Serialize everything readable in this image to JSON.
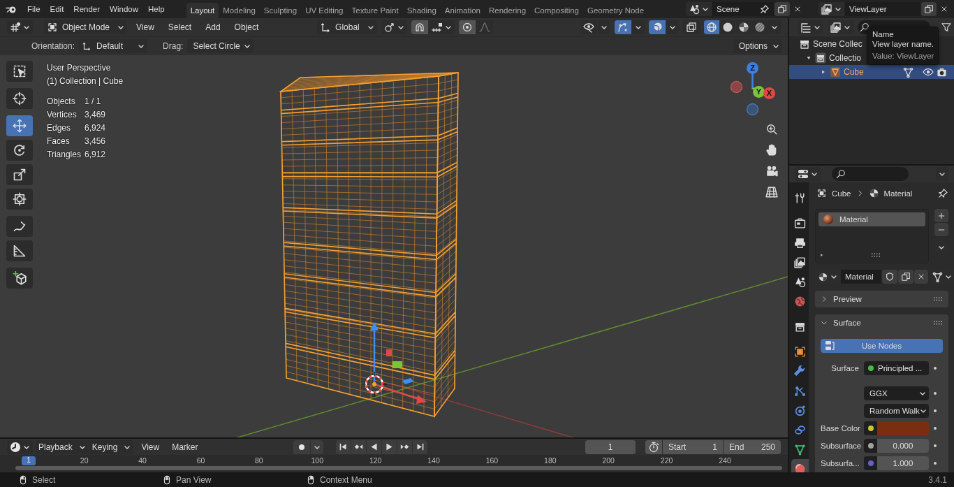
{
  "top_bar": {
    "menus": [
      "File",
      "Edit",
      "Render",
      "Window",
      "Help"
    ],
    "workspaces": [
      {
        "label": "Layout",
        "selected": true
      },
      {
        "label": "Modeling",
        "selected": false
      },
      {
        "label": "Sculpting",
        "selected": false
      },
      {
        "label": "UV Editing",
        "selected": false
      },
      {
        "label": "Texture Paint",
        "selected": false
      },
      {
        "label": "Shading",
        "selected": false
      },
      {
        "label": "Animation",
        "selected": false
      },
      {
        "label": "Rendering",
        "selected": false
      },
      {
        "label": "Compositing",
        "selected": false
      },
      {
        "label": "Geometry Node",
        "selected": false
      }
    ],
    "scene": "Scene",
    "view_layer": "ViewLayer"
  },
  "viewport_header": {
    "mode": "Object Mode",
    "menus": [
      "View",
      "Select",
      "Add",
      "Object"
    ],
    "orientation": "Global",
    "snap": false,
    "proportional": false,
    "toggles": [
      {
        "kind": "visibility",
        "on": false
      },
      {
        "kind": "gizmos",
        "on": true
      },
      {
        "kind": "overlays",
        "on": true
      },
      {
        "kind": "xray",
        "on": false
      }
    ],
    "shading": [
      {
        "kind": "wireframe",
        "selected": true
      },
      {
        "kind": "solid",
        "selected": false
      },
      {
        "kind": "material",
        "selected": false
      },
      {
        "kind": "rendered",
        "selected": false
      }
    ]
  },
  "tool_settings": {
    "orientation_label": "Orientation:",
    "orientation": "Default",
    "drag_label": "Drag:",
    "drag": "Select Circle",
    "options": "Options"
  },
  "toolbar": [
    {
      "tools": [
        {
          "kind": "select",
          "selected": false
        }
      ]
    },
    {
      "tools": [
        {
          "kind": "cursor",
          "selected": false
        }
      ]
    },
    {
      "tools": [
        {
          "kind": "move",
          "selected": true
        },
        {
          "kind": "rotate",
          "selected": false
        },
        {
          "kind": "scale",
          "selected": false
        },
        {
          "kind": "transform",
          "selected": false
        }
      ]
    },
    {
      "tools": [
        {
          "kind": "annotate",
          "selected": false
        },
        {
          "kind": "measure",
          "selected": false
        }
      ]
    },
    {
      "tools": [
        {
          "kind": "add_cube",
          "selected": false
        }
      ]
    }
  ],
  "viewport": {
    "perspective": "User Perspective",
    "collection": "(1) Collection | Cube",
    "stats": [
      {
        "label": "Objects",
        "value": "1 / 1"
      },
      {
        "label": "Vertices",
        "value": "3,469"
      },
      {
        "label": "Edges",
        "value": "6,924"
      },
      {
        "label": "Faces",
        "value": "3,456"
      },
      {
        "label": "Triangles",
        "value": "6,912"
      }
    ],
    "gizmo": {
      "x": "X",
      "y": "Y",
      "z": "Z"
    }
  },
  "timeline": {
    "menus": [
      "Playback",
      "Keying",
      "View",
      "Marker"
    ],
    "current_frame": "1",
    "start_label": "Start",
    "start": "1",
    "end_label": "End",
    "end": "250",
    "frame_marker": "1",
    "ruler": [
      "20",
      "40",
      "60",
      "80",
      "100",
      "120",
      "140",
      "160",
      "180",
      "200",
      "220",
      "240"
    ]
  },
  "outliner": {
    "tree": [
      {
        "label": "Scene Collec",
        "kind": "scene",
        "selected": false,
        "children": [
          {
            "label": "Collectio",
            "kind": "collection",
            "expanded": true,
            "selected": false,
            "children": [
              {
                "label": "Cube",
                "kind": "object",
                "expanded": false,
                "selected": true,
                "visible": true
              }
            ]
          }
        ]
      }
    ],
    "tooltip": {
      "title": "Name",
      "description": "View layer name.",
      "value": "Value: ViewLayer"
    }
  },
  "properties": {
    "tab_groups": [
      {
        "tabs": [
          {
            "kind": "tool",
            "selected": false
          }
        ]
      },
      {
        "tabs": [
          {
            "kind": "render",
            "selected": false
          },
          {
            "kind": "output",
            "selected": false
          },
          {
            "kind": "view_layer",
            "selected": false
          },
          {
            "kind": "scene",
            "selected": false
          },
          {
            "kind": "world",
            "selected": false
          }
        ]
      },
      {
        "tabs": [
          {
            "kind": "collection",
            "selected": false
          }
        ]
      },
      {
        "tabs": [
          {
            "kind": "object",
            "selected": false
          },
          {
            "kind": "modifiers",
            "selected": false
          },
          {
            "kind": "particles",
            "selected": false
          },
          {
            "kind": "physics",
            "selected": false
          },
          {
            "kind": "constraints",
            "selected": false
          },
          {
            "kind": "data",
            "selected": false
          },
          {
            "kind": "material",
            "selected": true
          }
        ]
      }
    ],
    "breadcrumb": [
      "Cube",
      "Material"
    ],
    "slots": [
      {
        "label": "Material",
        "selected": true
      }
    ],
    "datablock": "Material",
    "panels": [
      {
        "title": "Preview",
        "expanded": false
      },
      {
        "title": "Surface",
        "expanded": true
      }
    ],
    "use_nodes": "Use Nodes",
    "fields": [
      {
        "kind": "link",
        "label": "Surface",
        "value": "Principled ...",
        "color": "#3fbf3f"
      },
      {
        "kind": "dropdown",
        "value": "GGX"
      },
      {
        "kind": "dropdown",
        "value": "Random Walk"
      },
      {
        "kind": "color",
        "label": "Base Color",
        "color": "#7a2e10"
      },
      {
        "kind": "number",
        "label": "Subsurface",
        "value": "0.000",
        "color": "#a1a1a1"
      },
      {
        "kind": "number",
        "label": "Subsurfa...",
        "value": "1.000",
        "color": "#6363c7"
      }
    ]
  },
  "status_bar": {
    "hints": [
      {
        "kind": "left",
        "label": "Select"
      },
      {
        "kind": "middle",
        "label": "Pan View"
      },
      {
        "kind": "right",
        "label": "Context Menu"
      }
    ],
    "version": "3.4.1"
  }
}
